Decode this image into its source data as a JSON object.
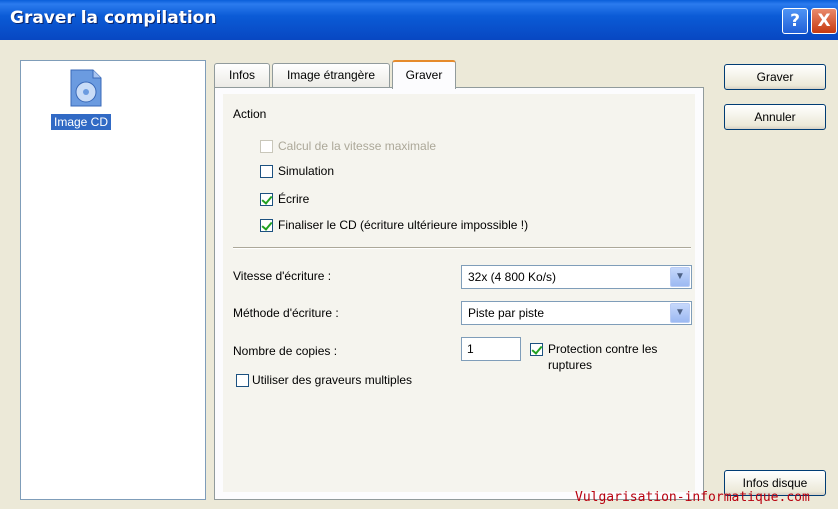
{
  "window": {
    "title": "Graver la compilation",
    "help_label": "?",
    "close_label": "X"
  },
  "left_panel": {
    "item_label": "Image CD",
    "item_icon": "cd-image-icon"
  },
  "tabs": [
    {
      "label": "Infos"
    },
    {
      "label": "Image étrangère"
    },
    {
      "label": "Graver",
      "active": true
    }
  ],
  "action": {
    "heading": "Action",
    "checkboxes": [
      {
        "label": "Calcul de la vitesse maximale",
        "checked": false,
        "enabled": false
      },
      {
        "label": "Simulation",
        "checked": false,
        "enabled": true
      },
      {
        "label": "Écrire",
        "checked": true,
        "enabled": true
      },
      {
        "label": "Finaliser le CD (écriture ultérieure impossible !)",
        "checked": true,
        "enabled": true
      }
    ]
  },
  "settings": {
    "speed_label": "Vitesse d'écriture :",
    "speed_value": "32x (4 800 Ko/s)",
    "method_label": "Méthode d'écriture :",
    "method_value": "Piste par piste",
    "copies_label": "Nombre de copies :",
    "copies_value": "1",
    "protection_label": "Protection contre les",
    "protection_label_2": "ruptures",
    "protection_checked": true,
    "multi_label": "Utiliser des graveurs multiples",
    "multi_checked": false
  },
  "buttons": {
    "burn": "Graver",
    "cancel": "Annuler",
    "disc_info": "Infos disque"
  },
  "watermark": "Vulgarisation-informatique.com",
  "colors": {
    "title_bar": "#0A5FD9",
    "selection": "#316AC5",
    "active_tab_accent": "#E68B2C",
    "watermark": "#B8000E"
  }
}
